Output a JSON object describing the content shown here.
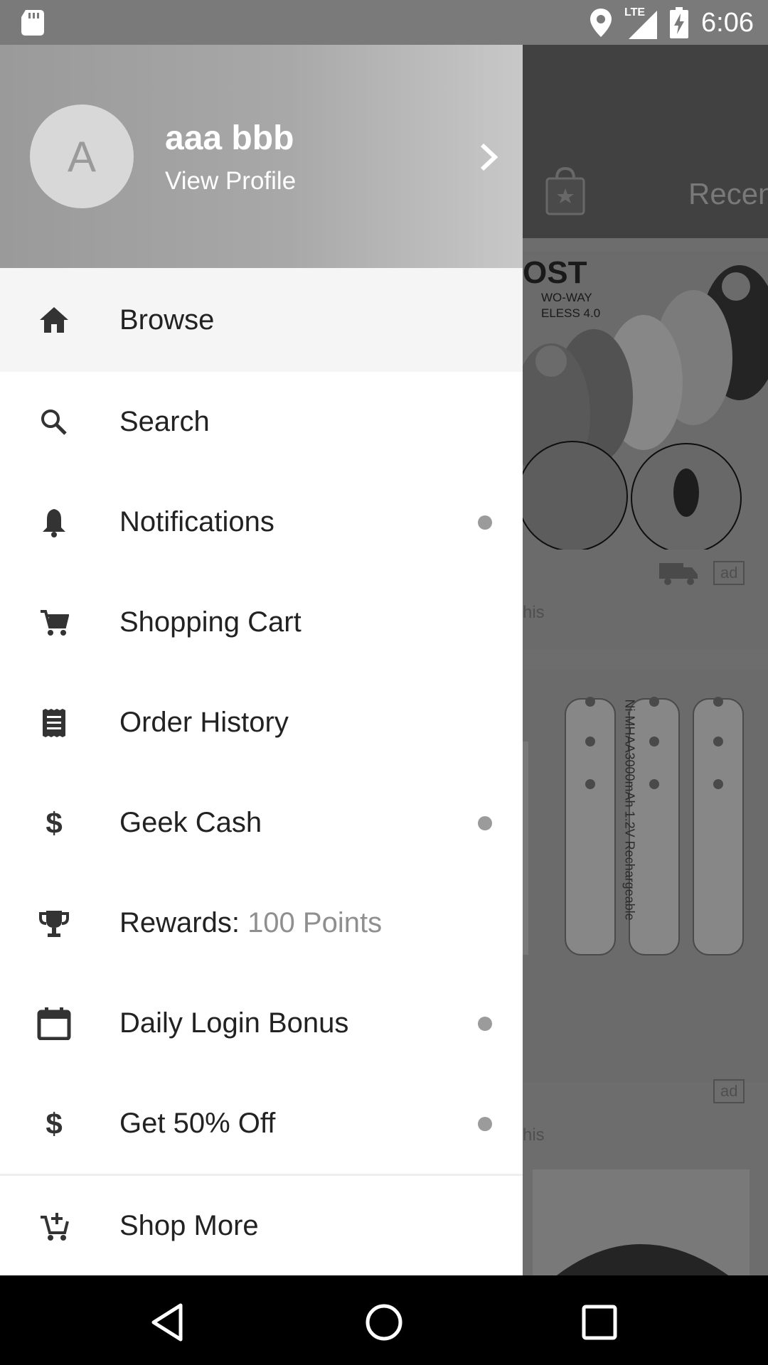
{
  "status_bar": {
    "time": "6:06",
    "icons": [
      "sd-card-icon",
      "location-icon",
      "lte-signal-icon",
      "battery-charging-icon"
    ],
    "network_label": "LTE"
  },
  "background_app": {
    "toolbar_tab_label": "Recen",
    "product_brand_text": "OST",
    "product_subtext_1": "WO-WAY",
    "product_subtext_2": "ELESS 4.0",
    "ad_label_1": "ad",
    "ad_label_2": "ad",
    "snippet_1": "his",
    "snippet_2": "his",
    "battery_text": "Ni-MHAA3000mAh 1.2V Rechargeable"
  },
  "drawer": {
    "avatar_letter": "A",
    "user_name": "aaa bbb",
    "view_profile": "View Profile",
    "items": [
      {
        "label": "Browse",
        "icon": "home-icon",
        "dot": false,
        "active": true
      },
      {
        "label": "Search",
        "icon": "search-icon",
        "dot": false
      },
      {
        "label": "Notifications",
        "icon": "bell-icon",
        "dot": true
      },
      {
        "label": "Shopping Cart",
        "icon": "cart-icon",
        "dot": false
      },
      {
        "label": "Order History",
        "icon": "receipt-icon",
        "dot": false
      },
      {
        "label": "Geek Cash",
        "icon": "dollar-icon",
        "dot": true
      },
      {
        "label": "Rewards: ",
        "points": "100 Points",
        "icon": "trophy-icon",
        "dot": false
      },
      {
        "label": "Daily Login Bonus",
        "icon": "calendar-icon",
        "dot": true
      },
      {
        "label": "Get 50% Off",
        "icon": "dollar-icon",
        "dot": true
      },
      {
        "label": "Shop More",
        "icon": "add-cart-icon",
        "dot": false
      }
    ]
  },
  "nav_bar": {
    "buttons": [
      "back-icon",
      "home-circle-icon",
      "recents-icon"
    ]
  },
  "colors": {
    "header_gradient_start": "#9a9a9a",
    "header_gradient_end": "#c8c8c8",
    "dot": "#9b9b9b",
    "points_text": "#8f8f8f"
  }
}
